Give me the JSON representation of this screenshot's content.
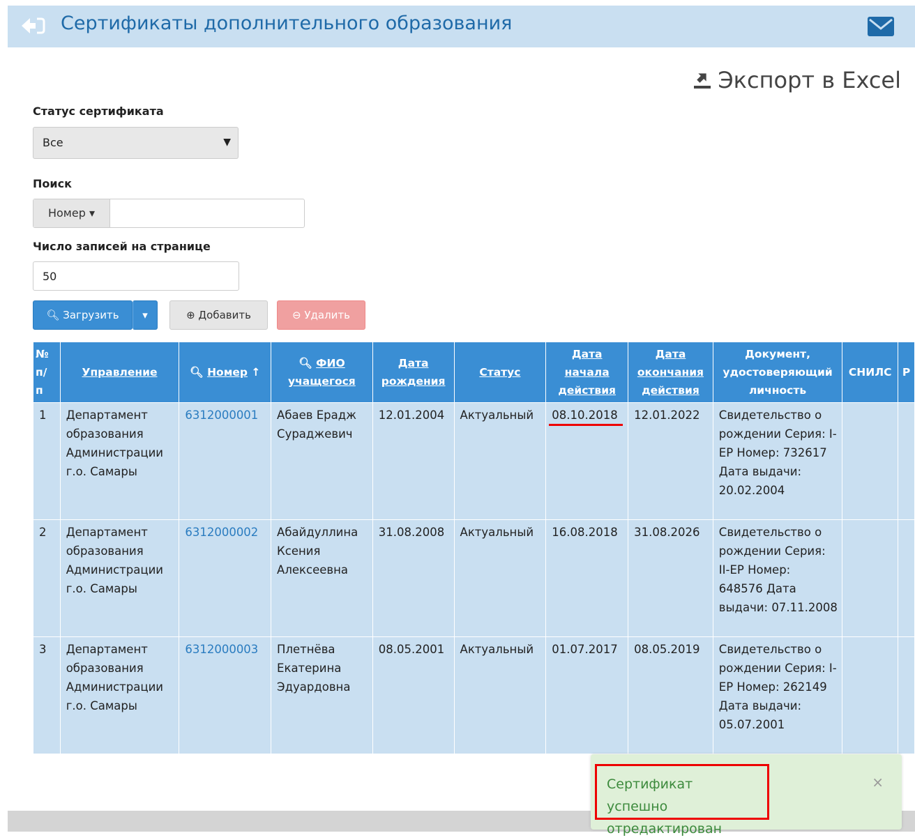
{
  "header": {
    "title": "Сертификаты дополнительного образования"
  },
  "export": {
    "label": "Экспорт в Excel"
  },
  "filters": {
    "status_label": "Статус сертификата",
    "status_value": "Все",
    "search_label": "Поиск",
    "search_addon": "Номер ▾",
    "search_value": "",
    "perpage_label": "Число записей на странице",
    "perpage_value": "50"
  },
  "buttons": {
    "load": "Загрузить",
    "add": "Добавить",
    "delete": "Удалить"
  },
  "table": {
    "headers": [
      "№ п/ п",
      "Управление",
      "Номер",
      "ФИО учащегося",
      "Дата рождения",
      "Статус",
      "Дата начала действия",
      "Дата окончания действия",
      "Документ, удостоверяющий личность",
      "СНИЛС",
      "Р"
    ],
    "rows": [
      {
        "n": "1",
        "dept": "Департамент образования Администрации г.о. Самары",
        "number": "6312000001",
        "name": "Абаев Ерадж Сураджевич",
        "birth": "12.01.2004",
        "status": "Актуальный",
        "start": "08.10.2018",
        "end": "12.01.2022",
        "doc": "Свидетельство о рождении Серия: I-ЕР Номер: 732617 Дата выдачи: 20.02.2004",
        "snils": ""
      },
      {
        "n": "2",
        "dept": "Департамент образования Администрации г.о. Самары",
        "number": "6312000002",
        "name": "Абайдуллина Ксения Алексеевна",
        "birth": "31.08.2008",
        "status": "Актуальный",
        "start": "16.08.2018",
        "end": "31.08.2026",
        "doc": "Свидетельство о рождении Серия: II-ЕР Номер: 648576 Дата выдачи: 07.11.2008",
        "snils": ""
      },
      {
        "n": "3",
        "dept": "Департамент образования Администрации г.о. Самары",
        "number": "6312000003",
        "name": "Плетнёва Екатерина Эдуардовна",
        "birth": "08.05.2001",
        "status": "Актуальный",
        "start": "01.07.2017",
        "end": "08.05.2019",
        "doc": "Свидетельство о рождении Серия: I-ЕР Номер: 262149 Дата выдачи: 05.07.2001",
        "snils": ""
      }
    ]
  },
  "toast": {
    "message": "Сертификат успешно отредактирован",
    "close": "×"
  },
  "colors": {
    "accent": "#3a8ed4",
    "header_bg": "#c9dff1",
    "danger": "#f0a0a0",
    "toast_bg": "#dff0d8"
  }
}
